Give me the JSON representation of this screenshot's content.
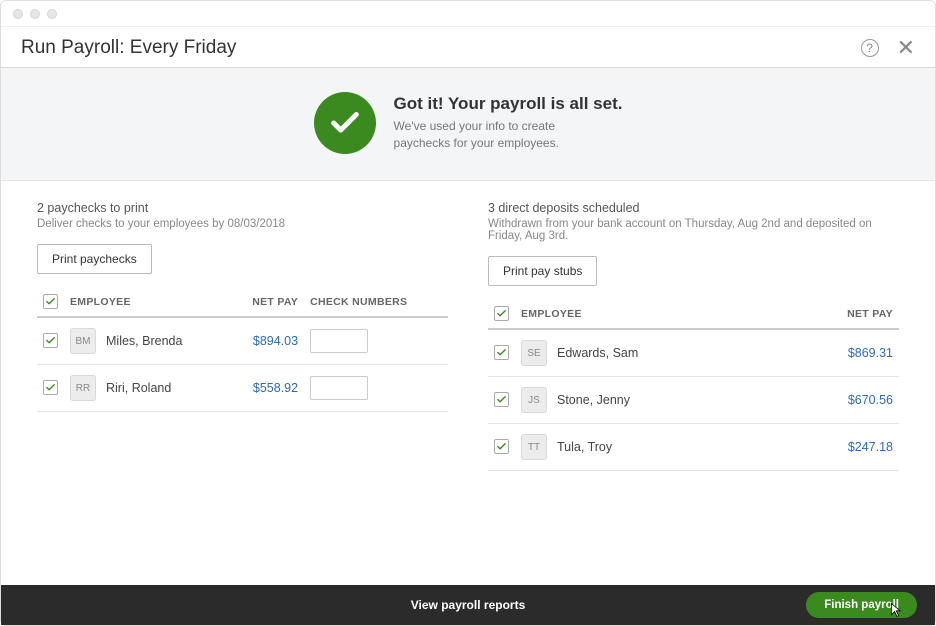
{
  "window": {
    "title": "Run Payroll: Every Friday"
  },
  "hero": {
    "title": "Got it! Your payroll is all set.",
    "subtitle": "We've used your info to create paychecks for your employees."
  },
  "paychecks": {
    "heading": "2 paychecks to print",
    "sub": "Deliver checks to your employees by 08/03/2018",
    "button": "Print paychecks",
    "columns": {
      "employee": "EMPLOYEE",
      "net": "NET PAY",
      "check": "CHECK NUMBERS"
    },
    "rows": [
      {
        "initials": "BM",
        "name": "Miles, Brenda",
        "net": "$894.03"
      },
      {
        "initials": "RR",
        "name": "Riri, Roland",
        "net": "$558.92"
      }
    ]
  },
  "deposits": {
    "heading": "3 direct deposits scheduled",
    "sub": "Withdrawn from your bank account on Thursday, Aug 2nd and deposited on Friday, Aug 3rd.",
    "button": "Print pay stubs",
    "columns": {
      "employee": "EMPLOYEE",
      "net": "NET PAY"
    },
    "rows": [
      {
        "initials": "SE",
        "name": "Edwards, Sam",
        "net": "$869.31"
      },
      {
        "initials": "JS",
        "name": "Stone, Jenny",
        "net": "$670.56"
      },
      {
        "initials": "TT",
        "name": "Tula, Troy",
        "net": "$247.18"
      }
    ]
  },
  "footer": {
    "reports_link": "View payroll reports",
    "finish": "Finish payroll"
  }
}
